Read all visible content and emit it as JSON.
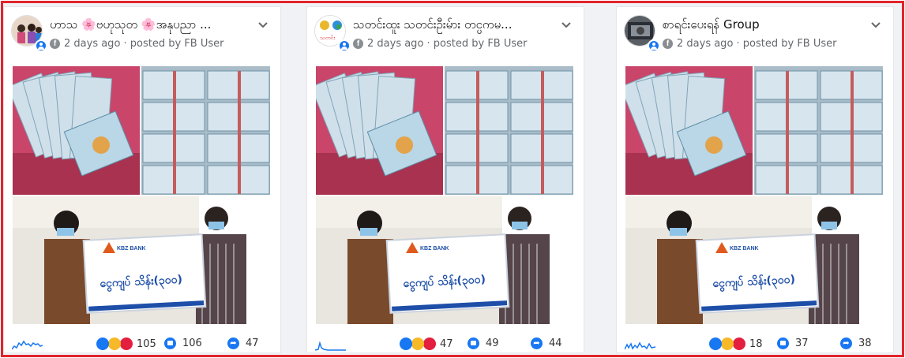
{
  "colors": {
    "frame": "#e2242b",
    "accent": "#1877f2",
    "bank_blue": "#1e4fa8"
  },
  "posts": [
    {
      "page_name": "ဟာသ 🌸ဗဟုသုတ 🌸အနုပညာ ...",
      "meta": "2 days ago · posted by FB User",
      "media_label": "ငွေကျပ် သိန်း(၃၀၀)",
      "bank_name": "KBZ BANK",
      "reactions": "105",
      "comments": "106",
      "shares": "47"
    },
    {
      "page_name": "သတင်းထူး သတင်းဦးမ်ား တင္ပကမ...",
      "meta": "2 days ago · posted by FB User",
      "media_label": "ငွေကျပ် သိန်း(၃၀၀)",
      "bank_name": "KBZ BANK",
      "reactions": "47",
      "comments": "49",
      "shares": "44"
    },
    {
      "page_name": "စာရင်းပေးရန် Group",
      "meta": "2 days ago · posted by FB User",
      "media_label": "ငွေကျပ် သိန်း(၃၀၀)",
      "bank_name": "KBZ BANK",
      "reactions": "18",
      "comments": "37",
      "shares": "38"
    }
  ],
  "icons": {
    "avatar_badge": "group-icon",
    "source": "facebook-icon",
    "menu": "chevron-down-icon",
    "reactions": "like-haha-love-icons",
    "comments": "comment-icon",
    "shares": "share-icon",
    "trend": "sparkline-icon"
  }
}
